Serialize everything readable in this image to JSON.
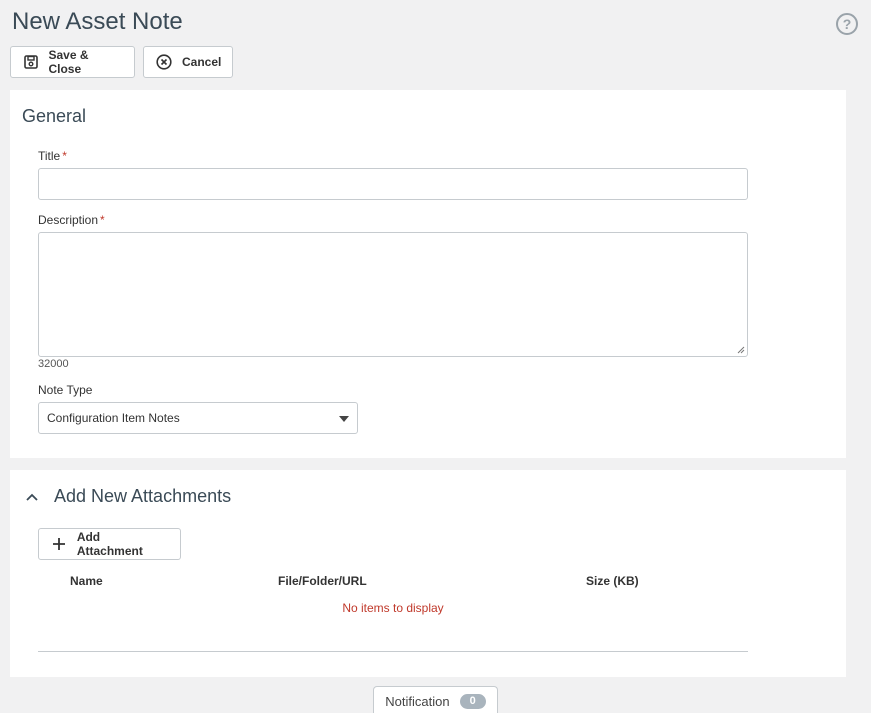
{
  "header": {
    "title": "New Asset Note",
    "help_icon": "question-circle-icon"
  },
  "toolbar": {
    "save_label": "Save & Close",
    "save_icon": "floppy-disk-icon",
    "cancel_label": "Cancel",
    "cancel_icon": "x-circle-icon"
  },
  "general": {
    "section_title": "General",
    "title_label": "Title",
    "title_value": "",
    "required_mark": "*",
    "description_label": "Description",
    "description_value": "",
    "description_counter": "32000",
    "note_type_label": "Note Type",
    "note_type_value": "Configuration Item Notes"
  },
  "attachments": {
    "section_title": "Add New Attachments",
    "collapse_icon": "chevron-up-icon",
    "add_label": "Add Attachment",
    "add_icon": "plus-icon",
    "columns": [
      "Name",
      "File/Folder/URL",
      "Size (KB)"
    ],
    "empty_message": "No items to display"
  },
  "footer": {
    "notification_label": "Notification",
    "notification_count": "0"
  },
  "colors": {
    "background": "#f1f1f2",
    "heading": "#3a4a56",
    "required": "#c0392b",
    "badge": "#a9b4bd"
  }
}
